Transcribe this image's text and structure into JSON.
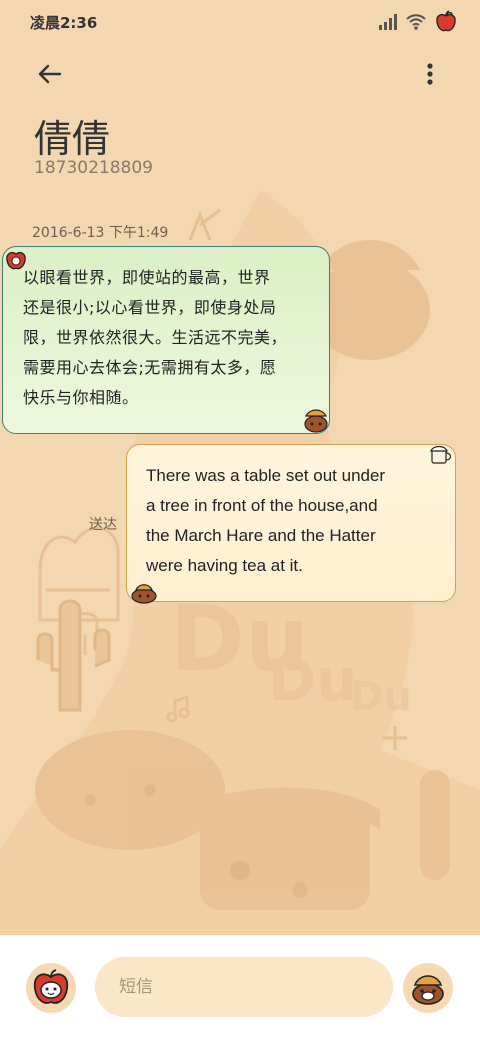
{
  "status_bar": {
    "time": "凌晨2:36"
  },
  "header": {
    "contact_name": "倩倩",
    "contact_number": "18730218809"
  },
  "conversation": {
    "timestamp": "2016-6-13 下午1:49",
    "messages": [
      {
        "direction": "incoming",
        "lines": [
          "以眼看世界，即使站的最高，世界",
          "还是很小;以心看世界，即使身处局",
          "限，世界依然很大。生活远不完美，",
          "需要用心去体会;无需拥有太多，愿",
          "快乐与你相随。"
        ]
      },
      {
        "direction": "outgoing",
        "lines": [
          "There was a table set out under",
          "a tree in front of the house,and",
          "the March Hare and the Hatter",
          "were having tea at it."
        ],
        "status": "送达"
      }
    ]
  },
  "compose": {
    "placeholder": "短信"
  },
  "icons": {
    "back": "arrow-left-icon",
    "more": "more-vertical-icon",
    "signal": "signal-icon",
    "wifi": "wifi-icon",
    "battery": "apple-battery-icon",
    "avatar": "apple-avatar-icon",
    "send": "dog-sticker-icon"
  },
  "colors": {
    "background": "#f3d7b0",
    "incoming_border": "#3f7f73",
    "outgoing_border": "#d4a052",
    "compose_bg": "#fbe6c7"
  }
}
